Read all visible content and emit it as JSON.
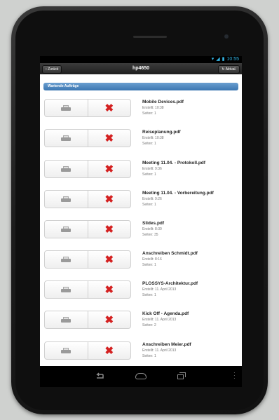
{
  "status": {
    "time": "10:55",
    "icons": [
      "wifi-icon",
      "signal-icon",
      "battery-icon"
    ]
  },
  "appbar": {
    "back_label": "Zurück",
    "title": "hp4650",
    "refresh_label": "Aktual."
  },
  "section": {
    "title": "Wartende Aufträge"
  },
  "jobs": [
    {
      "name": "Mobile Devices.pdf",
      "created": "Erstellt: 10:38",
      "pages": "Seiten: 1"
    },
    {
      "name": "Reiseplanung.pdf",
      "created": "Erstellt: 10:38",
      "pages": "Seiten: 1"
    },
    {
      "name": "Meeting 11.04. - Protokoll.pdf",
      "created": "Erstellt: 9:36",
      "pages": "Seiten: 1"
    },
    {
      "name": "Meeting 11.04. - Vorbereitung.pdf",
      "created": "Erstellt: 9:26",
      "pages": "Seiten: 1"
    },
    {
      "name": "Slides.pdf",
      "created": "Erstellt: 8:30",
      "pages": "Seiten: 35"
    },
    {
      "name": "Anschreiben Schmidt.pdf",
      "created": "Erstellt: 8:16",
      "pages": "Seiten: 1"
    },
    {
      "name": "PLOSSYS-Architektur.pdf",
      "created": "Erstellt: 11. April 2013",
      "pages": "Seiten: 1"
    },
    {
      "name": "Kick Off - Agenda.pdf",
      "created": "Erstellt: 11. April 2013",
      "pages": "Seiten: 2"
    },
    {
      "name": "Anschreiben Meier.pdf",
      "created": "Erstellt: 11. April 2013",
      "pages": "Seiten: 1"
    }
  ],
  "colors": {
    "section_bg": "#4a86c2",
    "delete": "#d42020",
    "status_accent": "#34b5e5"
  }
}
